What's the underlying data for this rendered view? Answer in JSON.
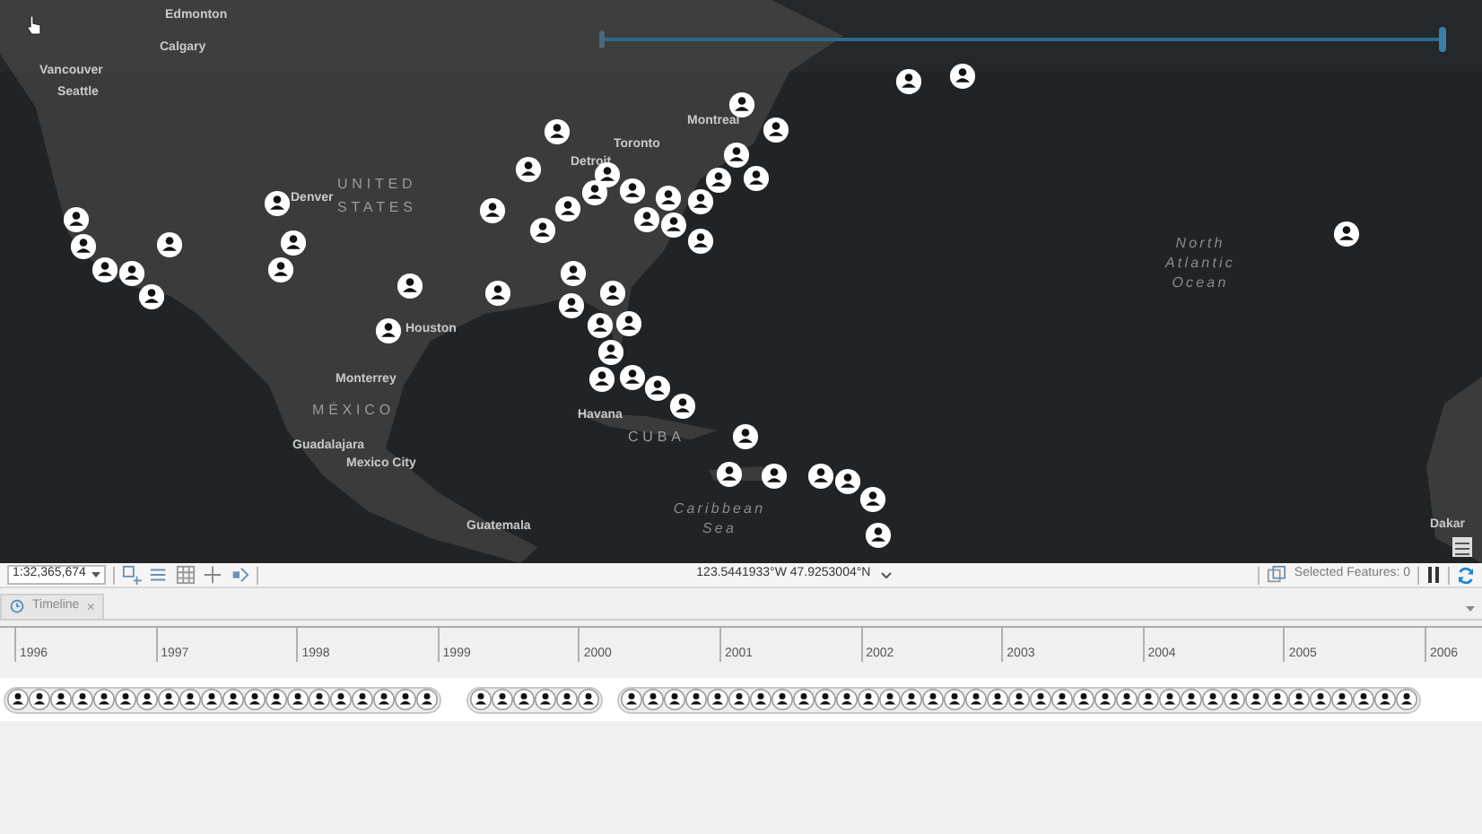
{
  "map": {
    "time_slider": {
      "level": 1
    },
    "labels": [
      {
        "text": "Edmonton",
        "kind": "city"
      },
      {
        "text": "Calgary",
        "kind": "city"
      },
      {
        "text": "Vancouver",
        "kind": "city"
      },
      {
        "text": "Seattle",
        "kind": "city"
      },
      {
        "text": "Denver",
        "kind": "city"
      },
      {
        "text": "UNITED STATES",
        "kind": "country"
      },
      {
        "text": "Houston",
        "kind": "city"
      },
      {
        "text": "Montreal",
        "kind": "city"
      },
      {
        "text": "Toronto",
        "kind": "city"
      },
      {
        "text": "Detroit",
        "kind": "city"
      },
      {
        "text": "Monterrey",
        "kind": "city"
      },
      {
        "text": "MÉXICO",
        "kind": "country"
      },
      {
        "text": "Guadalajara",
        "kind": "city"
      },
      {
        "text": "Mexico City",
        "kind": "city"
      },
      {
        "text": "Havana",
        "kind": "city"
      },
      {
        "text": "CUBA",
        "kind": "country"
      },
      {
        "text": "Guatemala",
        "kind": "city"
      },
      {
        "text": "Caribbean Sea",
        "kind": "water"
      },
      {
        "text": "North Atlantic Ocean",
        "kind": "water"
      },
      {
        "text": "Dakar",
        "kind": "city"
      }
    ]
  },
  "status_bar": {
    "scale": "1:32,365,674",
    "coordinates": "123.5441933°W 47.9253004°N",
    "selected_features": "Selected Features: 0"
  },
  "timeline": {
    "tab": {
      "label": "Timeline",
      "close": "×",
      "selected": true
    },
    "years": [
      "1996",
      "1997",
      "1998",
      "1999",
      "2000",
      "2001",
      "2002",
      "2003",
      "2004",
      "2005",
      "2006"
    ]
  }
}
